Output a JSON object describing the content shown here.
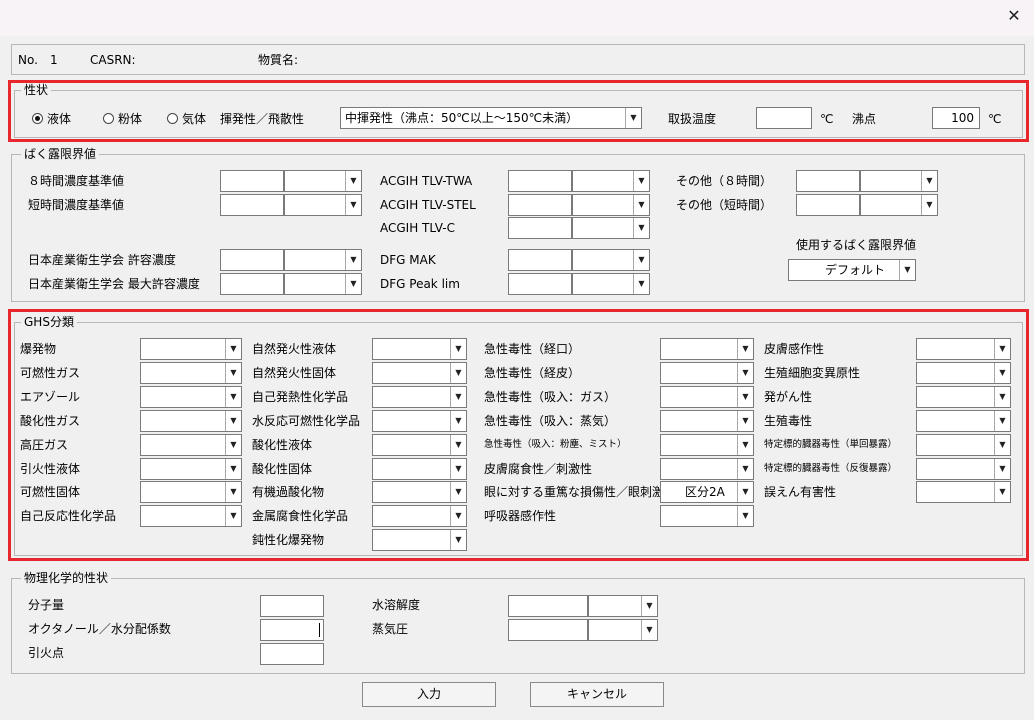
{
  "window": {
    "close_glyph": "✕"
  },
  "header": {
    "no_label": "No.",
    "no_value": "1",
    "casrn_label": "CASRN:",
    "substance_label": "物質名:"
  },
  "properties": {
    "title": "性状",
    "state_options": [
      "液体",
      "粉体",
      "気体"
    ],
    "selected_state": "液体",
    "volatility_label": "揮発性／飛散性",
    "volatility_value": "中揮発性（沸点：50℃以上～150℃未満）",
    "handling_temp_label": "取扱温度",
    "handling_temp_value": "",
    "temp_unit": "℃",
    "boiling_label": "沸点",
    "boiling_value": "100"
  },
  "exposure": {
    "title": "ばく露限界値",
    "col1": [
      "８時間濃度基準値",
      "短時間濃度基準値"
    ],
    "col1b": [
      "日本産業衛生学会 許容濃度",
      "日本産業衛生学会 最大許容濃度"
    ],
    "col2": [
      "ACGIH TLV-TWA",
      "ACGIH TLV-STEL",
      "ACGIH TLV-C"
    ],
    "col2b": [
      "DFG MAK",
      "DFG Peak lim"
    ],
    "col3": [
      "その他（８時間）",
      "その他（短時間）"
    ],
    "use_label": "使用するばく露限界値",
    "use_value": "デフォルト"
  },
  "ghs": {
    "title": "GHS分類",
    "col1": [
      "爆発物",
      "可燃性ガス",
      "エアゾール",
      "酸化性ガス",
      "高圧ガス",
      "引火性液体",
      "可燃性固体",
      "自己反応性化学品"
    ],
    "col2": [
      "自然発火性液体",
      "自然発火性固体",
      "自己発熱性化学品",
      "水反応可燃性化学品",
      "酸化性液体",
      "酸化性固体",
      "有機過酸化物",
      "金属腐食性化学品",
      "鈍性化爆発物"
    ],
    "col3": [
      "急性毒性（経口）",
      "急性毒性（経皮）",
      "急性毒性（吸入：ガス）",
      "急性毒性（吸入：蒸気）",
      "急性毒性（吸入：粉塵、ミスト）",
      "皮膚腐食性／刺激性",
      "眼に対する重篤な損傷性／眼刺激性",
      "呼吸器感作性"
    ],
    "col3_values": [
      "",
      "",
      "",
      "",
      "",
      "",
      "区分2A",
      ""
    ],
    "col4": [
      "皮膚感作性",
      "生殖細胞変異原性",
      "発がん性",
      "生殖毒性",
      "特定標的臓器毒性（単回暴露）",
      "特定標的臓器毒性（反復暴露）",
      "誤えん有害性"
    ]
  },
  "physchem": {
    "title": "物理化学的性状",
    "left": [
      "分子量",
      "オクタノール／水分配係数",
      "引火点"
    ],
    "right": [
      "水溶解度",
      "蒸気圧"
    ]
  },
  "buttons": {
    "submit": "入力",
    "cancel": "キャンセル"
  }
}
